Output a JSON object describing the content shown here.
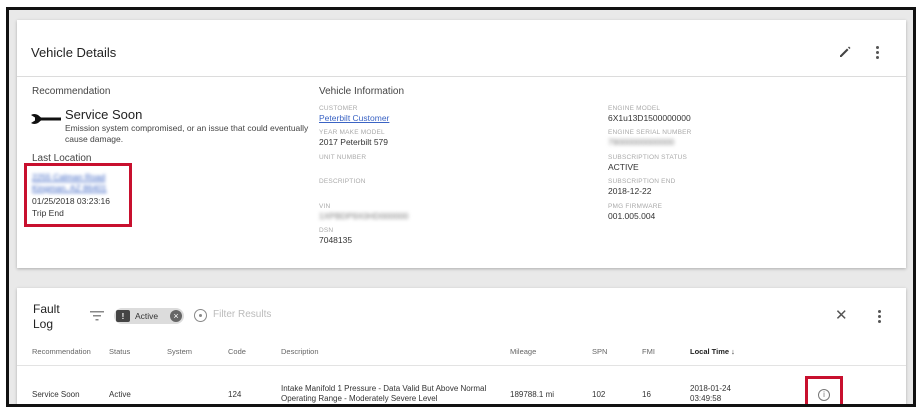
{
  "vehicle_details": {
    "title": "Vehicle Details",
    "recommendation": {
      "label": "Recommendation",
      "icon": "wrench-icon",
      "title": "Service Soon",
      "description": "Emission system compromised, or an issue that could eventually cause damage."
    },
    "last_location": {
      "label": "Last Location",
      "address": "2255 Calman Road Kingman, AZ 86401",
      "timestamp": "01/25/2018 03:23:16",
      "event": "Trip End"
    },
    "vehicle_information": {
      "label": "Vehicle Information",
      "customer_label": "CUSTOMER",
      "customer": "Peterbilt Customer",
      "year_make_model_label": "YEAR MAKE MODEL",
      "year_make_model": "2017 Peterbilt 579",
      "unit_number_label": "UNIT NUMBER",
      "description_label": "DESCRIPTION",
      "vin_label": "VIN",
      "vin": "1XPBDP9X0HD000000",
      "dsn_label": "DSN",
      "dsn": "7048135",
      "engine_model_label": "ENGINE MODEL",
      "engine_model": "6X1u13D1500000000",
      "engine_serial_label": "ENGINE SERIAL NUMBER",
      "engine_serial": "79000000000000",
      "subscription_status_label": "SUBSCRIPTION STATUS",
      "subscription_status": "ACTIVE",
      "subscription_end_label": "SUBSCRIPTION END",
      "subscription_end": "2018-12-22",
      "pmg_firmware_label": "PMG FIRMWARE",
      "pmg_firmware": "001.005.004"
    }
  },
  "fault_log": {
    "title": "Fault Log",
    "chip_label": "Active",
    "filter_placeholder": "Filter Results",
    "columns": {
      "recommendation": "Recommendation",
      "status": "Status",
      "system": "System",
      "code": "Code",
      "description": "Description",
      "mileage": "Mileage",
      "spn": "SPN",
      "fmi": "FMI",
      "local_time": "Local Time ↓"
    },
    "rows": [
      {
        "recommendation": "Service Soon",
        "status": "Active",
        "system": "",
        "code": "124",
        "description": "Intake Manifold 1 Pressure - Data Valid But Above Normal Operating Range - Moderately Severe Level",
        "mileage": "189788.1 mi",
        "spn": "102",
        "fmi": "16",
        "local_date": "2018-01-24",
        "local_time": "03:49:58"
      }
    ]
  },
  "colors": {
    "highlight": "#c8102e",
    "link": "#3a63c4"
  }
}
